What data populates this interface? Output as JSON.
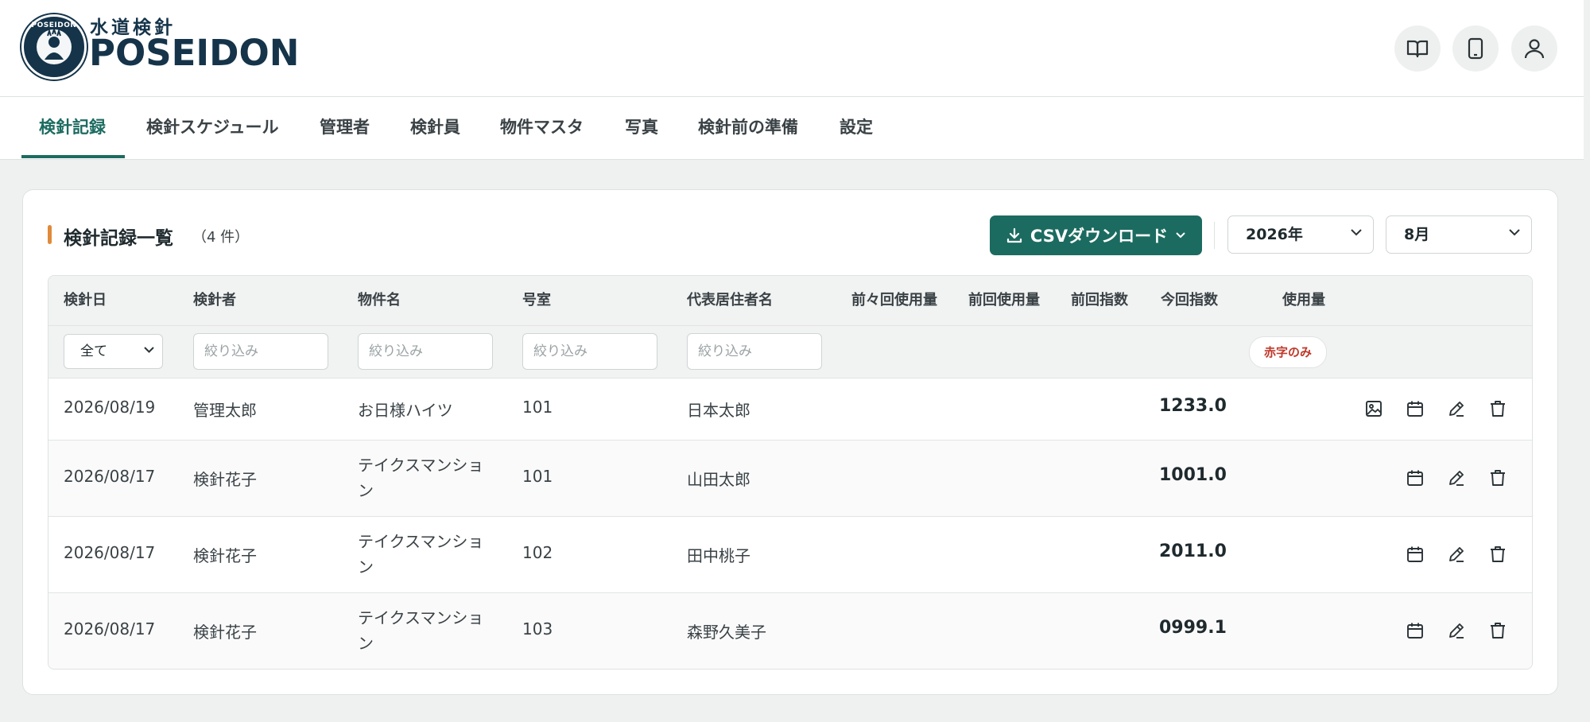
{
  "logo": {
    "ring_text": "POSEIDON",
    "subtitle": "水道検針",
    "title": "POSEIDON"
  },
  "header_buttons": [
    {
      "icon": "book-icon"
    },
    {
      "icon": "tablet-icon"
    },
    {
      "icon": "user-icon"
    }
  ],
  "tabs": [
    {
      "label": "検針記録",
      "active": true
    },
    {
      "label": "検針スケジュール"
    },
    {
      "label": "管理者"
    },
    {
      "label": "検針員"
    },
    {
      "label": "物件マスタ"
    },
    {
      "label": "写真"
    },
    {
      "label": "検針前の準備"
    },
    {
      "label": "設定"
    }
  ],
  "card": {
    "title": "検針記録一覧",
    "count": "（4 件）",
    "csv_button": "CSVダウンロード",
    "year_select": "2026年",
    "month_select": "8月"
  },
  "table": {
    "headers": [
      "検針日",
      "検針者",
      "物件名",
      "号室",
      "代表居住者名",
      "前々回使用量",
      "前回使用量",
      "前回指数",
      "今回指数",
      "使用量"
    ],
    "filters": {
      "date_select": "全て",
      "placeholder": "絞り込み",
      "red_only": "赤字のみ"
    },
    "rows": [
      {
        "date": "2026/08/19",
        "reader": "管理太郎",
        "property": "お日様ハイツ",
        "room": "101",
        "resident": "日本太郎",
        "current": "1233.0",
        "has_photo": true
      },
      {
        "date": "2026/08/17",
        "reader": "検針花子",
        "property": "テイクスマンション",
        "room": "101",
        "resident": "山田太郎",
        "current": "1001.0",
        "has_photo": false
      },
      {
        "date": "2026/08/17",
        "reader": "検針花子",
        "property": "テイクスマンション",
        "room": "102",
        "resident": "田中桃子",
        "current": "2011.0",
        "has_photo": false
      },
      {
        "date": "2026/08/17",
        "reader": "検針花子",
        "property": "テイクスマンション",
        "room": "103",
        "resident": "森野久美子",
        "current": "0999.1",
        "has_photo": false
      }
    ]
  },
  "colors": {
    "primary": "#1c6b60",
    "navy": "#15344a",
    "accent": "#e08a3a",
    "danger": "#c0392b"
  }
}
